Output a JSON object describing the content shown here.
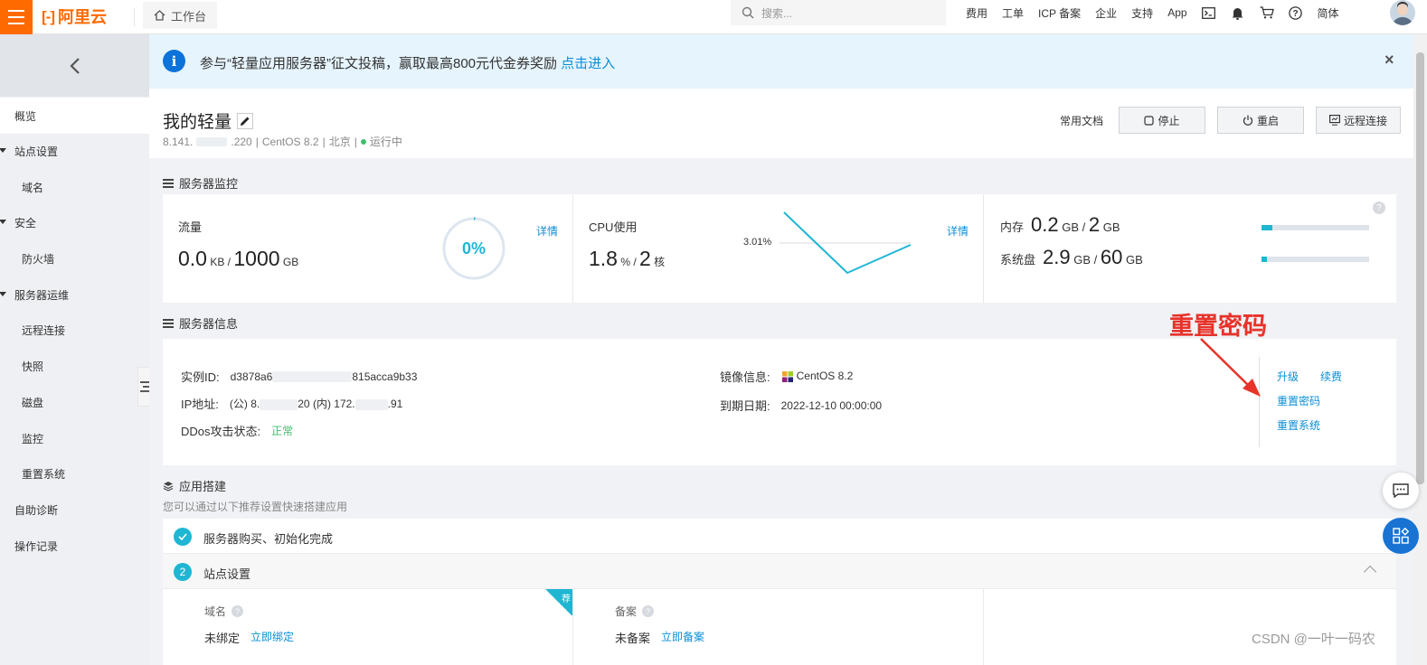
{
  "topbar": {
    "logo_text": "阿里云",
    "workbench_label": "工作台",
    "search_placeholder": "搜索...",
    "nav": [
      "费用",
      "工单",
      "ICP 备案",
      "企业",
      "支持",
      "App"
    ],
    "lang": "简体",
    "icons": [
      "terminal-icon",
      "bell-icon",
      "cart-icon",
      "help-icon"
    ]
  },
  "sidebar": {
    "items": [
      {
        "label": "概览",
        "active": true
      },
      {
        "label": "站点设置",
        "expandable": true
      },
      {
        "label": "域名"
      },
      {
        "label": "安全",
        "expandable": true
      },
      {
        "label": "防火墙"
      },
      {
        "label": "服务器运维",
        "expandable": true
      },
      {
        "label": "远程连接"
      },
      {
        "label": "快照"
      },
      {
        "label": "磁盘"
      },
      {
        "label": "监控"
      },
      {
        "label": "重置系统"
      },
      {
        "label": "自助诊断"
      },
      {
        "label": "操作记录"
      }
    ]
  },
  "notice": {
    "text": "参与“轻量应用服务器”征文投稿，赢取最高800元代金券奖励",
    "link": "点击进入",
    "close": "×"
  },
  "header": {
    "title": "我的轻量",
    "ip_prefix": "8.141.",
    "ip_suffix": ".220",
    "os": "CentOS 8.2",
    "region": "北京",
    "status": "运行中",
    "docs": "常用文档",
    "btn_stop": "停止",
    "btn_restart": "重启",
    "btn_remote": "远程连接"
  },
  "monitor": {
    "section_title": "服务器监控",
    "traffic": {
      "label": "流量",
      "used": "0.0",
      "used_unit": "KB",
      "total": "1000",
      "total_unit": "GB",
      "percent": "0%",
      "detail": "详情"
    },
    "cpu": {
      "label": "CPU使用",
      "used": "1.8",
      "used_unit": "%",
      "cores": "2",
      "cores_unit": "核",
      "peak": "3.01%",
      "detail": "详情"
    },
    "memory": {
      "label": "内存",
      "used": "0.2",
      "used_unit": "GB",
      "total": "2",
      "total_unit": "GB",
      "fill": 0.1
    },
    "disk": {
      "label": "系统盘",
      "used": "2.9",
      "used_unit": "GB",
      "total": "60",
      "total_unit": "GB",
      "fill": 0.05
    },
    "help": "?"
  },
  "info": {
    "section_title": "服务器信息",
    "instance_id_label": "实例ID:",
    "instance_id_prefix": "d3878a6",
    "instance_id_suffix": "815acca9b33",
    "ip_label": "IP地址:",
    "ip_public_prefix": "(公) 8.",
    "ip_public_suffix": "20",
    "ip_private_prefix": "(内) 172.",
    "ip_private_suffix": ".91",
    "ddos_label": "DDos攻击状态:",
    "ddos_value": "正常",
    "image_label": "镜像信息:",
    "image_value": "CentOS 8.2",
    "expire_label": "到期日期:",
    "expire_value": "2022-12-10 00:00:00",
    "links": {
      "upgrade": "升级",
      "renew": "续费",
      "reset_password": "重置密码",
      "reset_system": "重置系统"
    }
  },
  "annotation": "重置密码",
  "app": {
    "section_title": "应用搭建",
    "subtitle": "您可以通过以下推荐设置快速搭建应用",
    "step1": "服务器购买、初始化完成",
    "step2_num": "2",
    "step2": "站点设置",
    "domain_label": "域名",
    "domain_status": "未绑定",
    "domain_action": "立即绑定",
    "recommend_badge": "荐",
    "icp_label": "备案",
    "icp_status": "未备案",
    "icp_action": "立即备案"
  },
  "watermark": "CSDN @一叶一码农"
}
